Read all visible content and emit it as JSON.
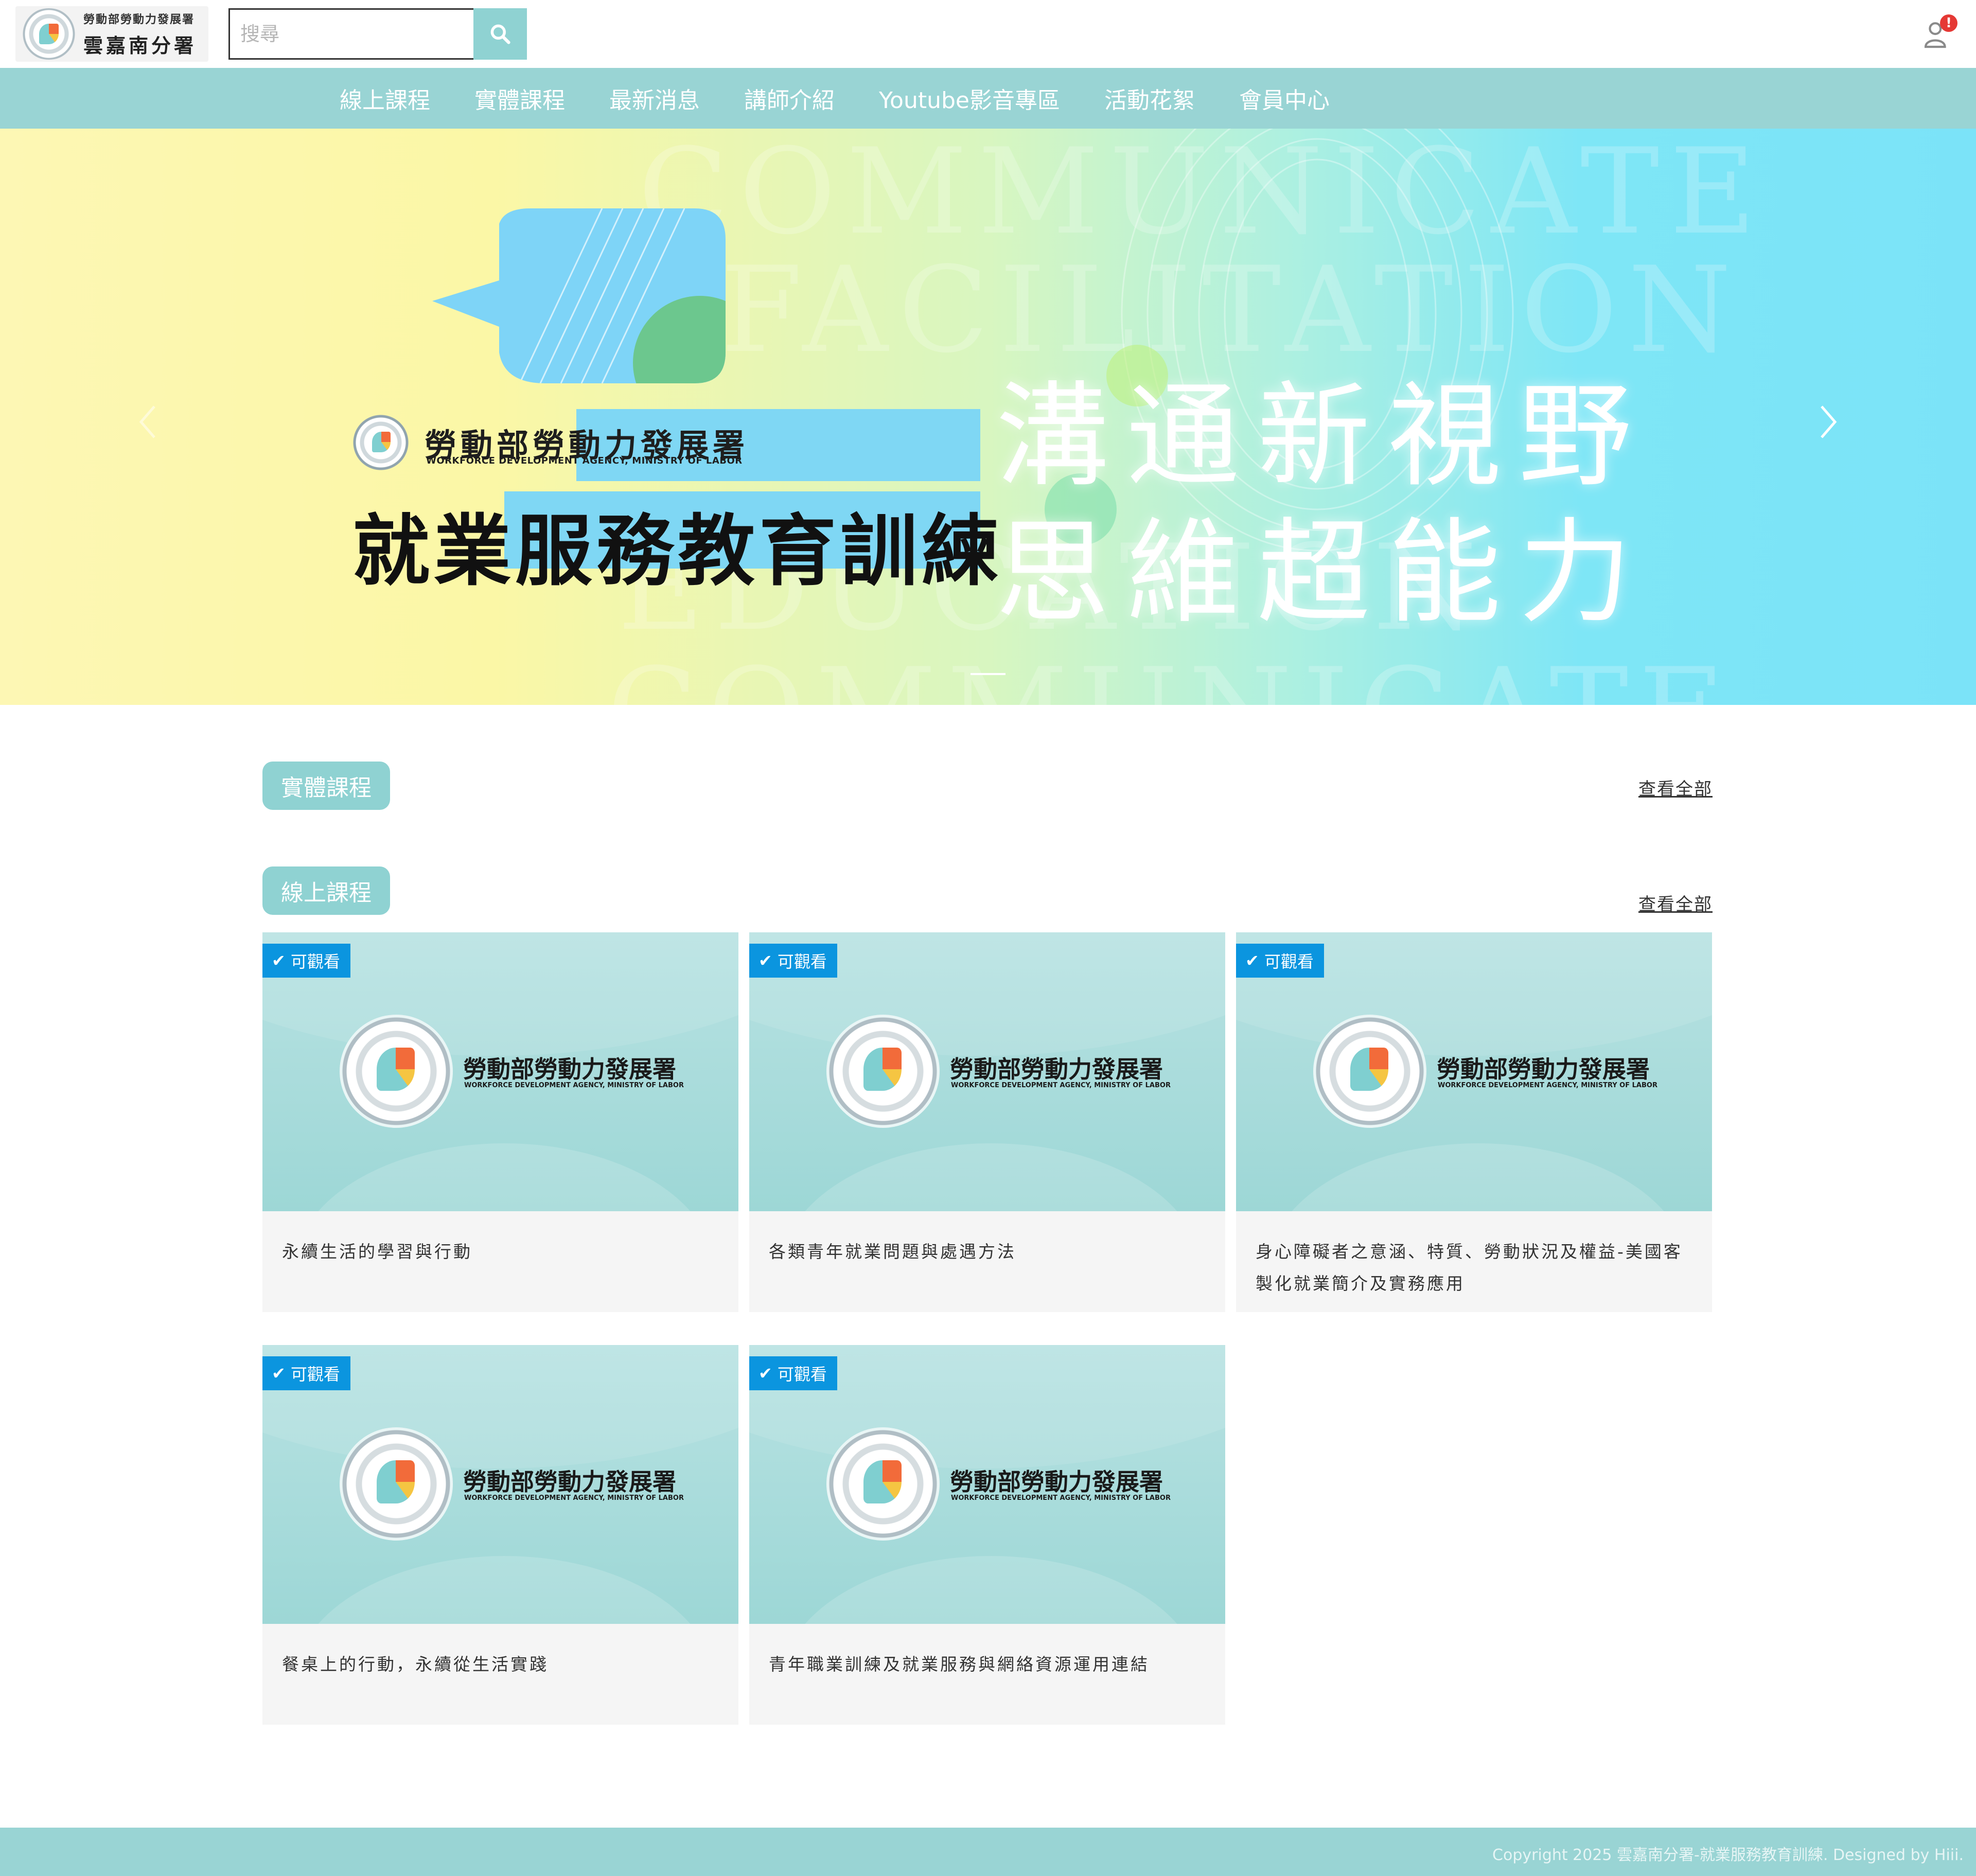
{
  "header": {
    "brand_sub": "勞動部勞動力發展署",
    "brand_main": "雲嘉南分署",
    "search_placeholder": "搜尋",
    "notification_count": "!"
  },
  "nav": {
    "items": [
      {
        "label": "線上課程"
      },
      {
        "label": "實體課程"
      },
      {
        "label": "最新消息"
      },
      {
        "label": "講師介紹"
      },
      {
        "label": "Youtube影音專區"
      },
      {
        "label": "活動花絮"
      },
      {
        "label": "會員中心"
      }
    ]
  },
  "hero": {
    "org_name": "勞動部勞動力發展署",
    "org_name_en": "WORKFORCE DEVELOPMENT AGENCY, MINISTRY OF LABOR",
    "title": "就業服務教育訓練",
    "slogan_line1": "溝通新視野",
    "slogan_line2": "思維超能力",
    "bg_words": [
      "COMMUNICATE",
      "FACILITATION",
      "EDUCATION",
      "COMMUNICATE"
    ]
  },
  "sections": {
    "physical": {
      "label": "實體課程",
      "view_all": "查看全部"
    },
    "online": {
      "label": "線上課程",
      "view_all": "查看全部"
    }
  },
  "cards": [
    {
      "badge": "可觀看",
      "org": "勞動部勞動力發展署",
      "org_en": "WORKFORCE DEVELOPMENT AGENCY, MINISTRY OF LABOR",
      "title": "永續生活的學習與行動"
    },
    {
      "badge": "可觀看",
      "org": "勞動部勞動力發展署",
      "org_en": "WORKFORCE DEVELOPMENT AGENCY, MINISTRY OF LABOR",
      "title": "各類青年就業問題與處遇方法"
    },
    {
      "badge": "可觀看",
      "org": "勞動部勞動力發展署",
      "org_en": "WORKFORCE DEVELOPMENT AGENCY, MINISTRY OF LABOR",
      "title": "身心障礙者之意涵、特質、勞動狀況及權益-美國客製化就業簡介及實務應用"
    },
    {
      "badge": "可觀看",
      "org": "勞動部勞動力發展署",
      "org_en": "WORKFORCE DEVELOPMENT AGENCY, MINISTRY OF LABOR",
      "title": "餐桌上的行動，永續從生活實踐"
    },
    {
      "badge": "可觀看",
      "org": "勞動部勞動力發展署",
      "org_en": "WORKFORCE DEVELOPMENT AGENCY, MINISTRY OF LABOR",
      "title": "青年職業訓練及就業服務與網絡資源運用連結"
    }
  ],
  "footer": {
    "copyright": "Copyright 2025 雲嘉南分署-就業服務教育訓練. Designed by Hiii."
  },
  "colors": {
    "accent": "#99d4d4",
    "pill": "#8fd2d2",
    "badge": "#0b95df",
    "notification": "#e53935"
  },
  "icons": {
    "search": "search-icon",
    "user": "user-icon",
    "check": "check-icon",
    "prev": "chevron-left-icon",
    "next": "chevron-right-icon"
  }
}
